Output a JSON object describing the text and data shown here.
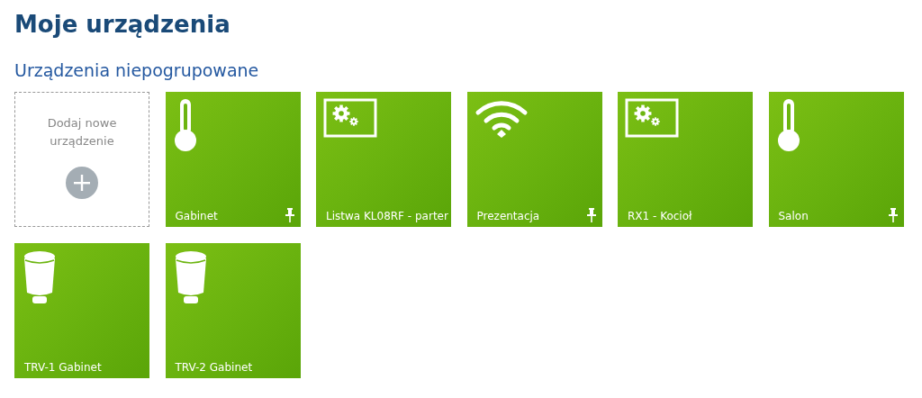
{
  "title": "Moje urządzenia",
  "section": {
    "title": "Urządzenia niepogrupowane",
    "add_tile": {
      "label": "Dodaj nowe urządzenie"
    },
    "devices": [
      {
        "name": "Gabinet",
        "kind": "thermometer",
        "pinned": true
      },
      {
        "name": "Listwa KL08RF - parter",
        "kind": "controller",
        "pinned": false
      },
      {
        "name": "Prezentacja",
        "kind": "wifi",
        "pinned": true
      },
      {
        "name": "RX1 - Kocioł",
        "kind": "controller",
        "pinned": false
      },
      {
        "name": "Salon",
        "kind": "thermometer",
        "pinned": true
      },
      {
        "name": "TRV-1 Gabinet",
        "kind": "valve",
        "pinned": false
      },
      {
        "name": "TRV-2 Gabinet",
        "kind": "valve",
        "pinned": false
      }
    ]
  }
}
